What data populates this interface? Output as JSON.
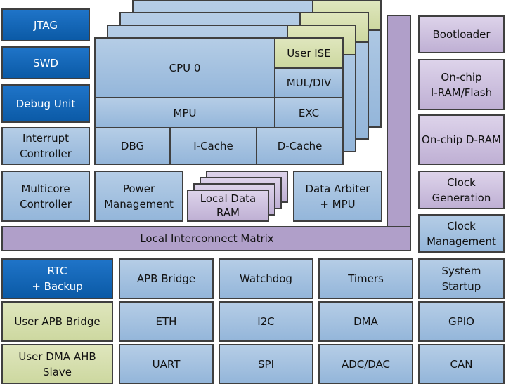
{
  "colors": {
    "core_blue": "#a8c4e0",
    "debug_blue": "#1466b8",
    "user_green": "#d6dfae",
    "memory_purple": "#cbbfdc",
    "interconnect": "#b09fc9"
  },
  "left": [
    "JTAG",
    "SWD",
    "Debug Unit",
    "Interrupt\nController",
    "Multicore\nController"
  ],
  "right": [
    "Bootloader",
    "On-chip\nI-RAM/Flash",
    "On-chip D-RAM",
    "Clock\nGeneration",
    "Clock\nManagement"
  ],
  "cpu": {
    "core": "CPU 0",
    "user_ise": "User ISE",
    "muldiv": "MUL/DIV",
    "mpu": "MPU",
    "exc": "EXC",
    "dbg": "DBG",
    "icache": "I-Cache",
    "dcache": "D-Cache"
  },
  "middle": {
    "power": "Power\nManagement",
    "local_ram": "Local Data\nRAM",
    "arbiter": "Data Arbiter\n+ MPU"
  },
  "interconnect": "Local Interconnect Matrix",
  "bottom": [
    [
      "RTC\n+ Backup",
      "APB Bridge",
      "Watchdog",
      "Timers",
      "System\nStartup"
    ],
    [
      "User APB Bridge",
      "ETH",
      "I2C",
      "DMA",
      "GPIO"
    ],
    [
      "User DMA AHB\nSlave",
      "UART",
      "SPI",
      "ADC/DAC",
      "CAN"
    ]
  ]
}
